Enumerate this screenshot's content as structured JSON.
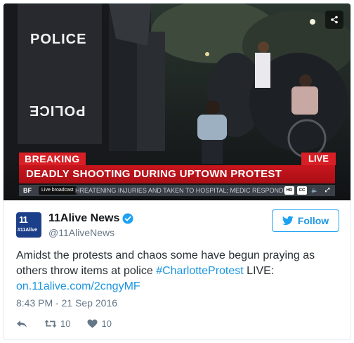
{
  "media": {
    "breaking_label": "BREAKING",
    "live_label": "LIVE",
    "headline": "DEADLY SHOOTING DURING UPTOWN PROTEST",
    "ticker_left": "BF",
    "ticker_live_badge": "Live broadcast",
    "ticker_text": "HREATENING INJURIES AND TAKEN TO HOSPITAL; MEDIC RESPONDING",
    "ticker_controls": [
      "HD",
      "CC"
    ],
    "police_text_top": "POLICE",
    "police_text_bottom": "POLICE",
    "share_icon": "share-icon"
  },
  "account": {
    "avatar_number": "11",
    "avatar_tag": "#11Alive",
    "display_name": "11Alive News",
    "handle": "@11AliveNews",
    "verified": true
  },
  "follow_button": {
    "label": "Follow",
    "icon": "twitter-bird-icon"
  },
  "tweet": {
    "text_line1": "Amidst the protests and chaos some have begun praying as",
    "text_line2_before": "others throw items at police ",
    "hashtag": "#CharlotteProtest",
    "text_line2_after": " LIVE:",
    "link": "on.11alive.com/2cngyMF",
    "timestamp": "8:43 PM - 21 Sep 2016"
  },
  "actions": {
    "reply_icon": "reply-icon",
    "retweet_count": "10",
    "like_count": "10"
  },
  "colors": {
    "accent": "#1da1f2",
    "link": "#1b95e0",
    "breaking_red": "#d81f26",
    "muted": "#657786"
  }
}
